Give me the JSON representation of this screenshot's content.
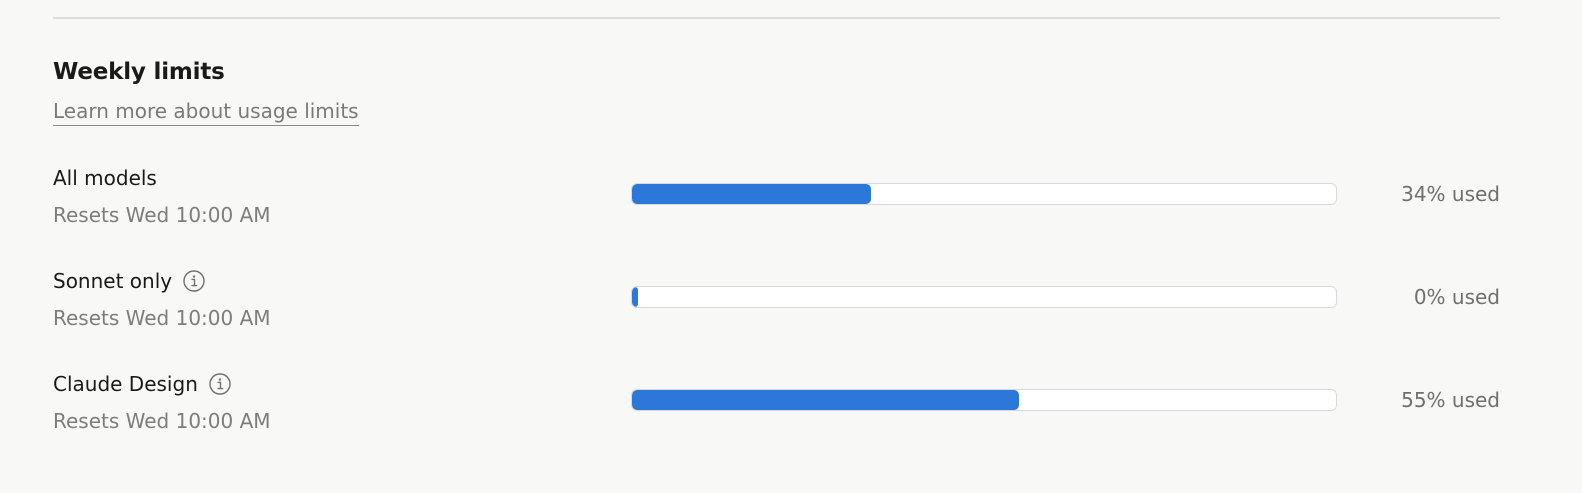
{
  "section": {
    "title": "Weekly limits",
    "learn_more_label": "Learn more about usage limits"
  },
  "limits": [
    {
      "name": "All models",
      "has_info_icon": false,
      "reset_text": "Resets Wed 10:00 AM",
      "used_percent": 34,
      "used_label": "34% used"
    },
    {
      "name": "Sonnet only",
      "has_info_icon": true,
      "info_icon": "info-icon",
      "reset_text": "Resets Wed 10:00 AM",
      "used_percent": 0,
      "used_label": "0% used"
    },
    {
      "name": "Claude Design",
      "has_info_icon": true,
      "info_icon": "info-icon",
      "reset_text": "Resets Wed 10:00 AM",
      "used_percent": 55,
      "used_label": "55% used"
    }
  ],
  "colors": {
    "bar_fill": "#2b78d9",
    "bar_track": "#ffffff",
    "background": "#f8f8f6"
  }
}
